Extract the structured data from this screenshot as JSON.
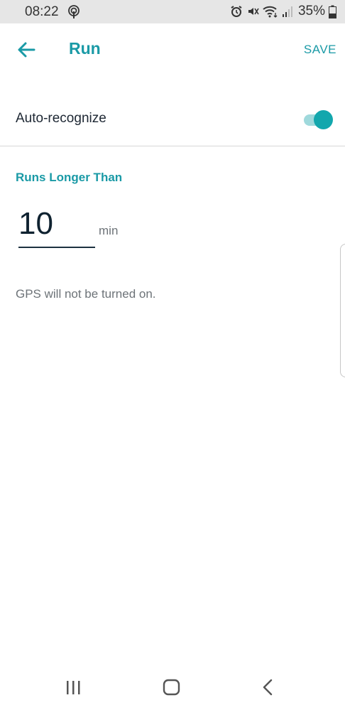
{
  "status_bar": {
    "time": "08:22",
    "battery": "35%",
    "icons": [
      "podcast-icon",
      "alarm-icon",
      "mute-icon",
      "wifi-icon",
      "signal-icon",
      "battery-icon"
    ]
  },
  "app_bar": {
    "title": "Run",
    "save_label": "SAVE",
    "back_icon": "back-arrow-icon"
  },
  "settings": {
    "auto_recognize_label": "Auto-recognize",
    "auto_recognize_on": true,
    "section_header": "Runs Longer Than",
    "duration_value": "10",
    "duration_unit": "min",
    "gps_note": "GPS will not be turned on."
  },
  "nav_bar": {
    "icons": [
      "recents-icon",
      "home-icon",
      "back-icon"
    ]
  },
  "colors": {
    "accent": "#1a9aa6",
    "toggle_thumb": "#13a7ad",
    "toggle_track": "#9fd9dc",
    "status_bar_bg": "#e6e6e6"
  }
}
